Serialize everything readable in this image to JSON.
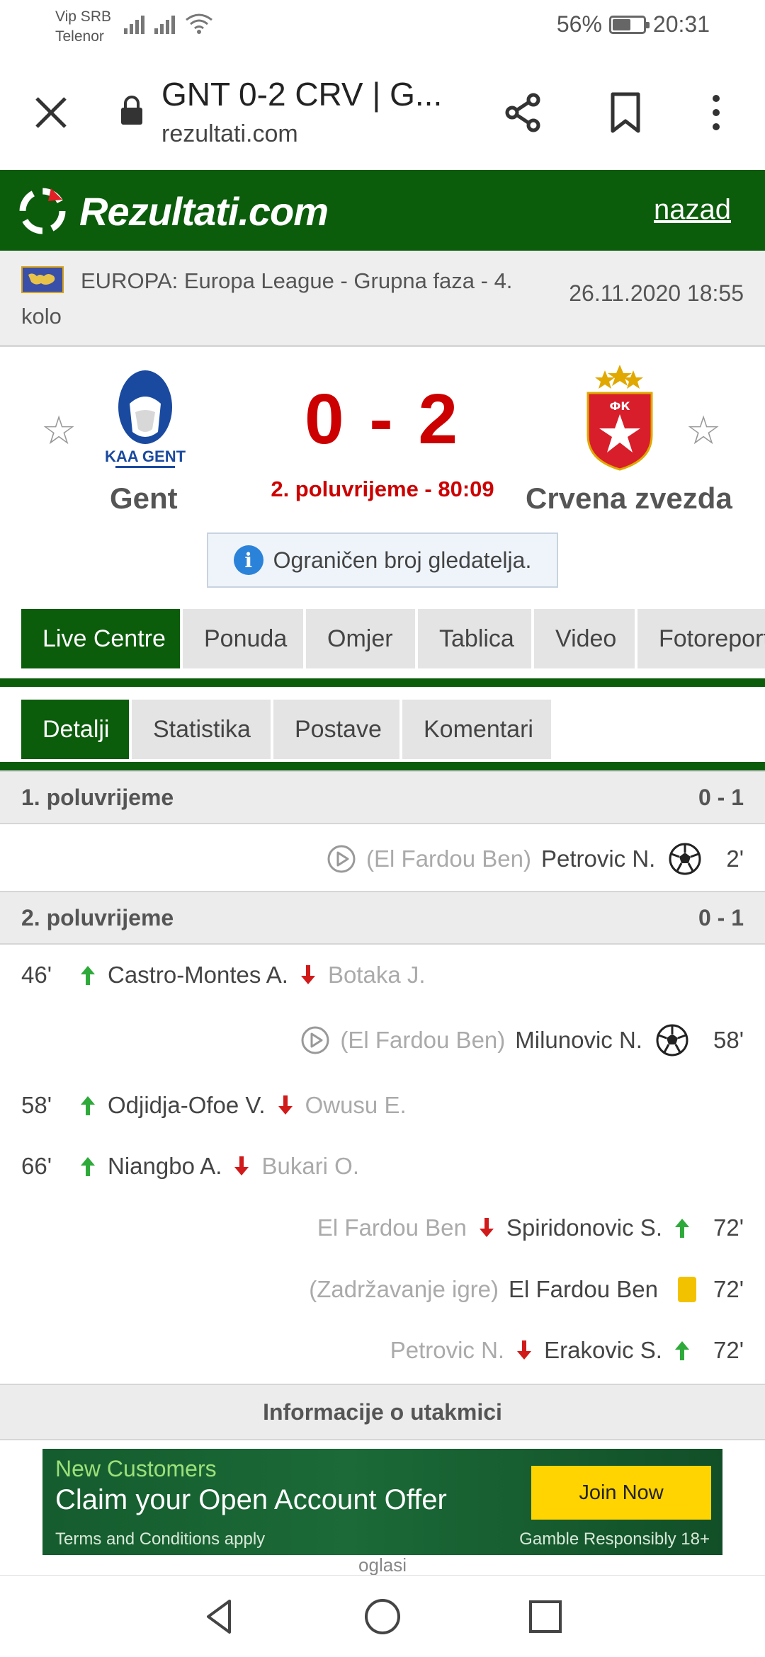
{
  "status_bar": {
    "carrier_line1": "Vip SRB",
    "carrier_line2": "Telenor",
    "battery": "56%",
    "battery_level": 0.56,
    "time": "20:31"
  },
  "browser": {
    "tab_title": "GNT 0-2 CRV | G...",
    "domain": "rezultati.com"
  },
  "site": {
    "logo_text": "Rezultati.com",
    "back_link": "nazad"
  },
  "league": {
    "name": "EUROPA: Europa League - Grupna faza - 4. kolo",
    "datetime": "26.11.2020 18:55"
  },
  "match": {
    "home_team": "Gent",
    "home_logo_text": "KAA GENT",
    "away_team": "Crvena zvezda",
    "away_logo_text": "ФК",
    "score": "0 - 2",
    "status": "2. poluvrijeme - 80:09",
    "spectators_note": "Ograničen broj gledatelja."
  },
  "tabs_main": [
    "Live Centre",
    "Ponuda",
    "Omjer",
    "Tablica",
    "Video",
    "Fotoreport"
  ],
  "tabs_sub": [
    "Detalji",
    "Statistika",
    "Postave",
    "Komentari"
  ],
  "periods": [
    {
      "label": "1. poluvrijeme",
      "score": "0 - 1",
      "events": [
        {
          "type": "goal",
          "side": "away",
          "minute": "2'",
          "assist": "(El Fardou Ben)",
          "player": "Petrovic N."
        }
      ]
    },
    {
      "label": "2. poluvrijeme",
      "score": "0 - 1",
      "events": [
        {
          "type": "sub",
          "side": "home",
          "minute": "46'",
          "in": "Castro-Montes A.",
          "out": "Botaka J."
        },
        {
          "type": "goal",
          "side": "away",
          "minute": "58'",
          "assist": "(El Fardou Ben)",
          "player": "Milunovic N."
        },
        {
          "type": "sub",
          "side": "home",
          "minute": "58'",
          "in": "Odjidja-Ofoe V.",
          "out": "Owusu E."
        },
        {
          "type": "sub",
          "side": "home",
          "minute": "66'",
          "in": "Niangbo A.",
          "out": "Bukari O."
        },
        {
          "type": "sub",
          "side": "away",
          "minute": "72'",
          "in": "Spiridonovic S.",
          "out": "El Fardou Ben"
        },
        {
          "type": "card",
          "side": "away",
          "minute": "72'",
          "reason": "(Zadržavanje igre)",
          "player": "El Fardou Ben"
        },
        {
          "type": "sub",
          "side": "away",
          "minute": "72'",
          "in": "Erakovic S.",
          "out": "Petrovic N."
        }
      ]
    }
  ],
  "info_section": "Informacije o utakmici",
  "ad": {
    "line1": "New Customers",
    "line2": "Claim your Open Account Offer",
    "terms": "Terms and Conditions apply",
    "responsible": "Gamble Responsibly 18+",
    "cta": "Join Now",
    "label": "oglasi"
  },
  "colors": {
    "brand_green": "#0b5c0b",
    "score_red": "#cc0000",
    "arrow_in": "#2eaa3a",
    "arrow_out": "#d11a1a",
    "yellow_card": "#f2c200"
  }
}
